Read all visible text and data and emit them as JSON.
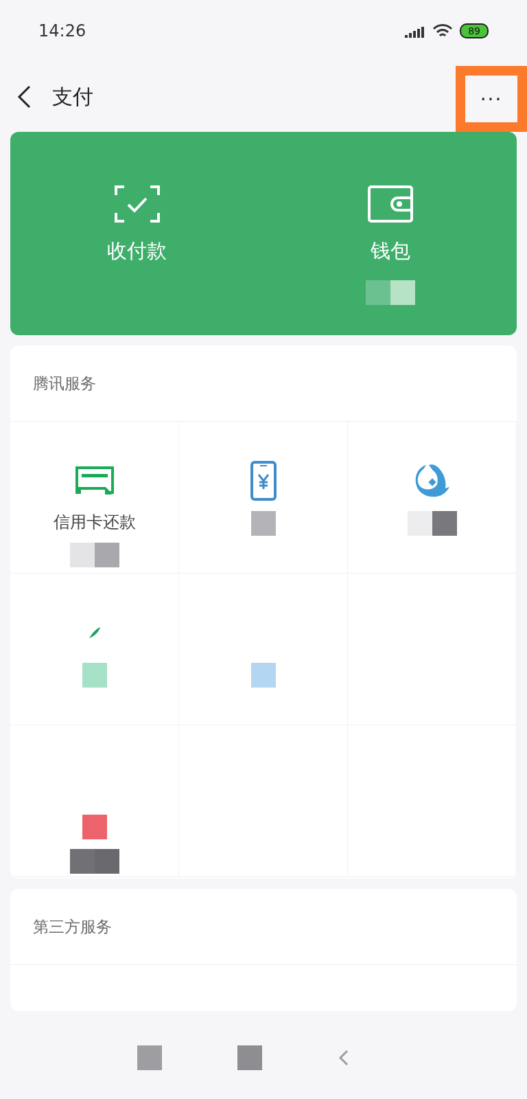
{
  "status_bar": {
    "time": "14:26",
    "battery": "89"
  },
  "header": {
    "title": "支付",
    "more": "···",
    "highlighted": true
  },
  "hero": [
    {
      "kind": "scan",
      "label": "收付款"
    },
    {
      "kind": "wallet",
      "label": "钱包",
      "mosaic": [
        {
          "color": "#6cc191"
        },
        {
          "color": "#b6e2c6"
        }
      ]
    }
  ],
  "sections": [
    {
      "title": "腾讯服务",
      "cells": [
        {
          "kind": "card",
          "label": "信用卡还款",
          "mosaic": [
            {
              "color": "#e4e4e7"
            },
            {
              "color": "#a9a8ac"
            }
          ]
        },
        {
          "kind": "phone",
          "mosaic": [
            {
              "color": "#b4b3b7"
            }
          ]
        },
        {
          "kind": "fish",
          "mosaic": [
            {
              "color": "#ededf0"
            },
            {
              "color": "#79787c"
            }
          ]
        },
        {
          "kind": "leaf",
          "mosaic": [
            {
              "color": "#a5e1c6"
            }
          ]
        },
        {
          "kind": "none",
          "mosaic": [
            {
              "color": "#b3d6f2"
            }
          ]
        },
        {
          "kind": "none"
        },
        {
          "kind": "none",
          "mosaic": [
            {
              "color": "#ec636b"
            }
          ],
          "mosaic2": [
            {
              "color": "#717074"
            },
            {
              "color": "#69686c"
            }
          ]
        },
        {
          "kind": "none"
        },
        {
          "kind": "none"
        }
      ]
    },
    {
      "title": "第三方服务"
    }
  ],
  "nav": [
    {
      "kind": "square",
      "color": "#9e9da1"
    },
    {
      "kind": "square",
      "color": "#8e8d91"
    },
    {
      "kind": "back",
      "color": "#9e9da1"
    }
  ]
}
